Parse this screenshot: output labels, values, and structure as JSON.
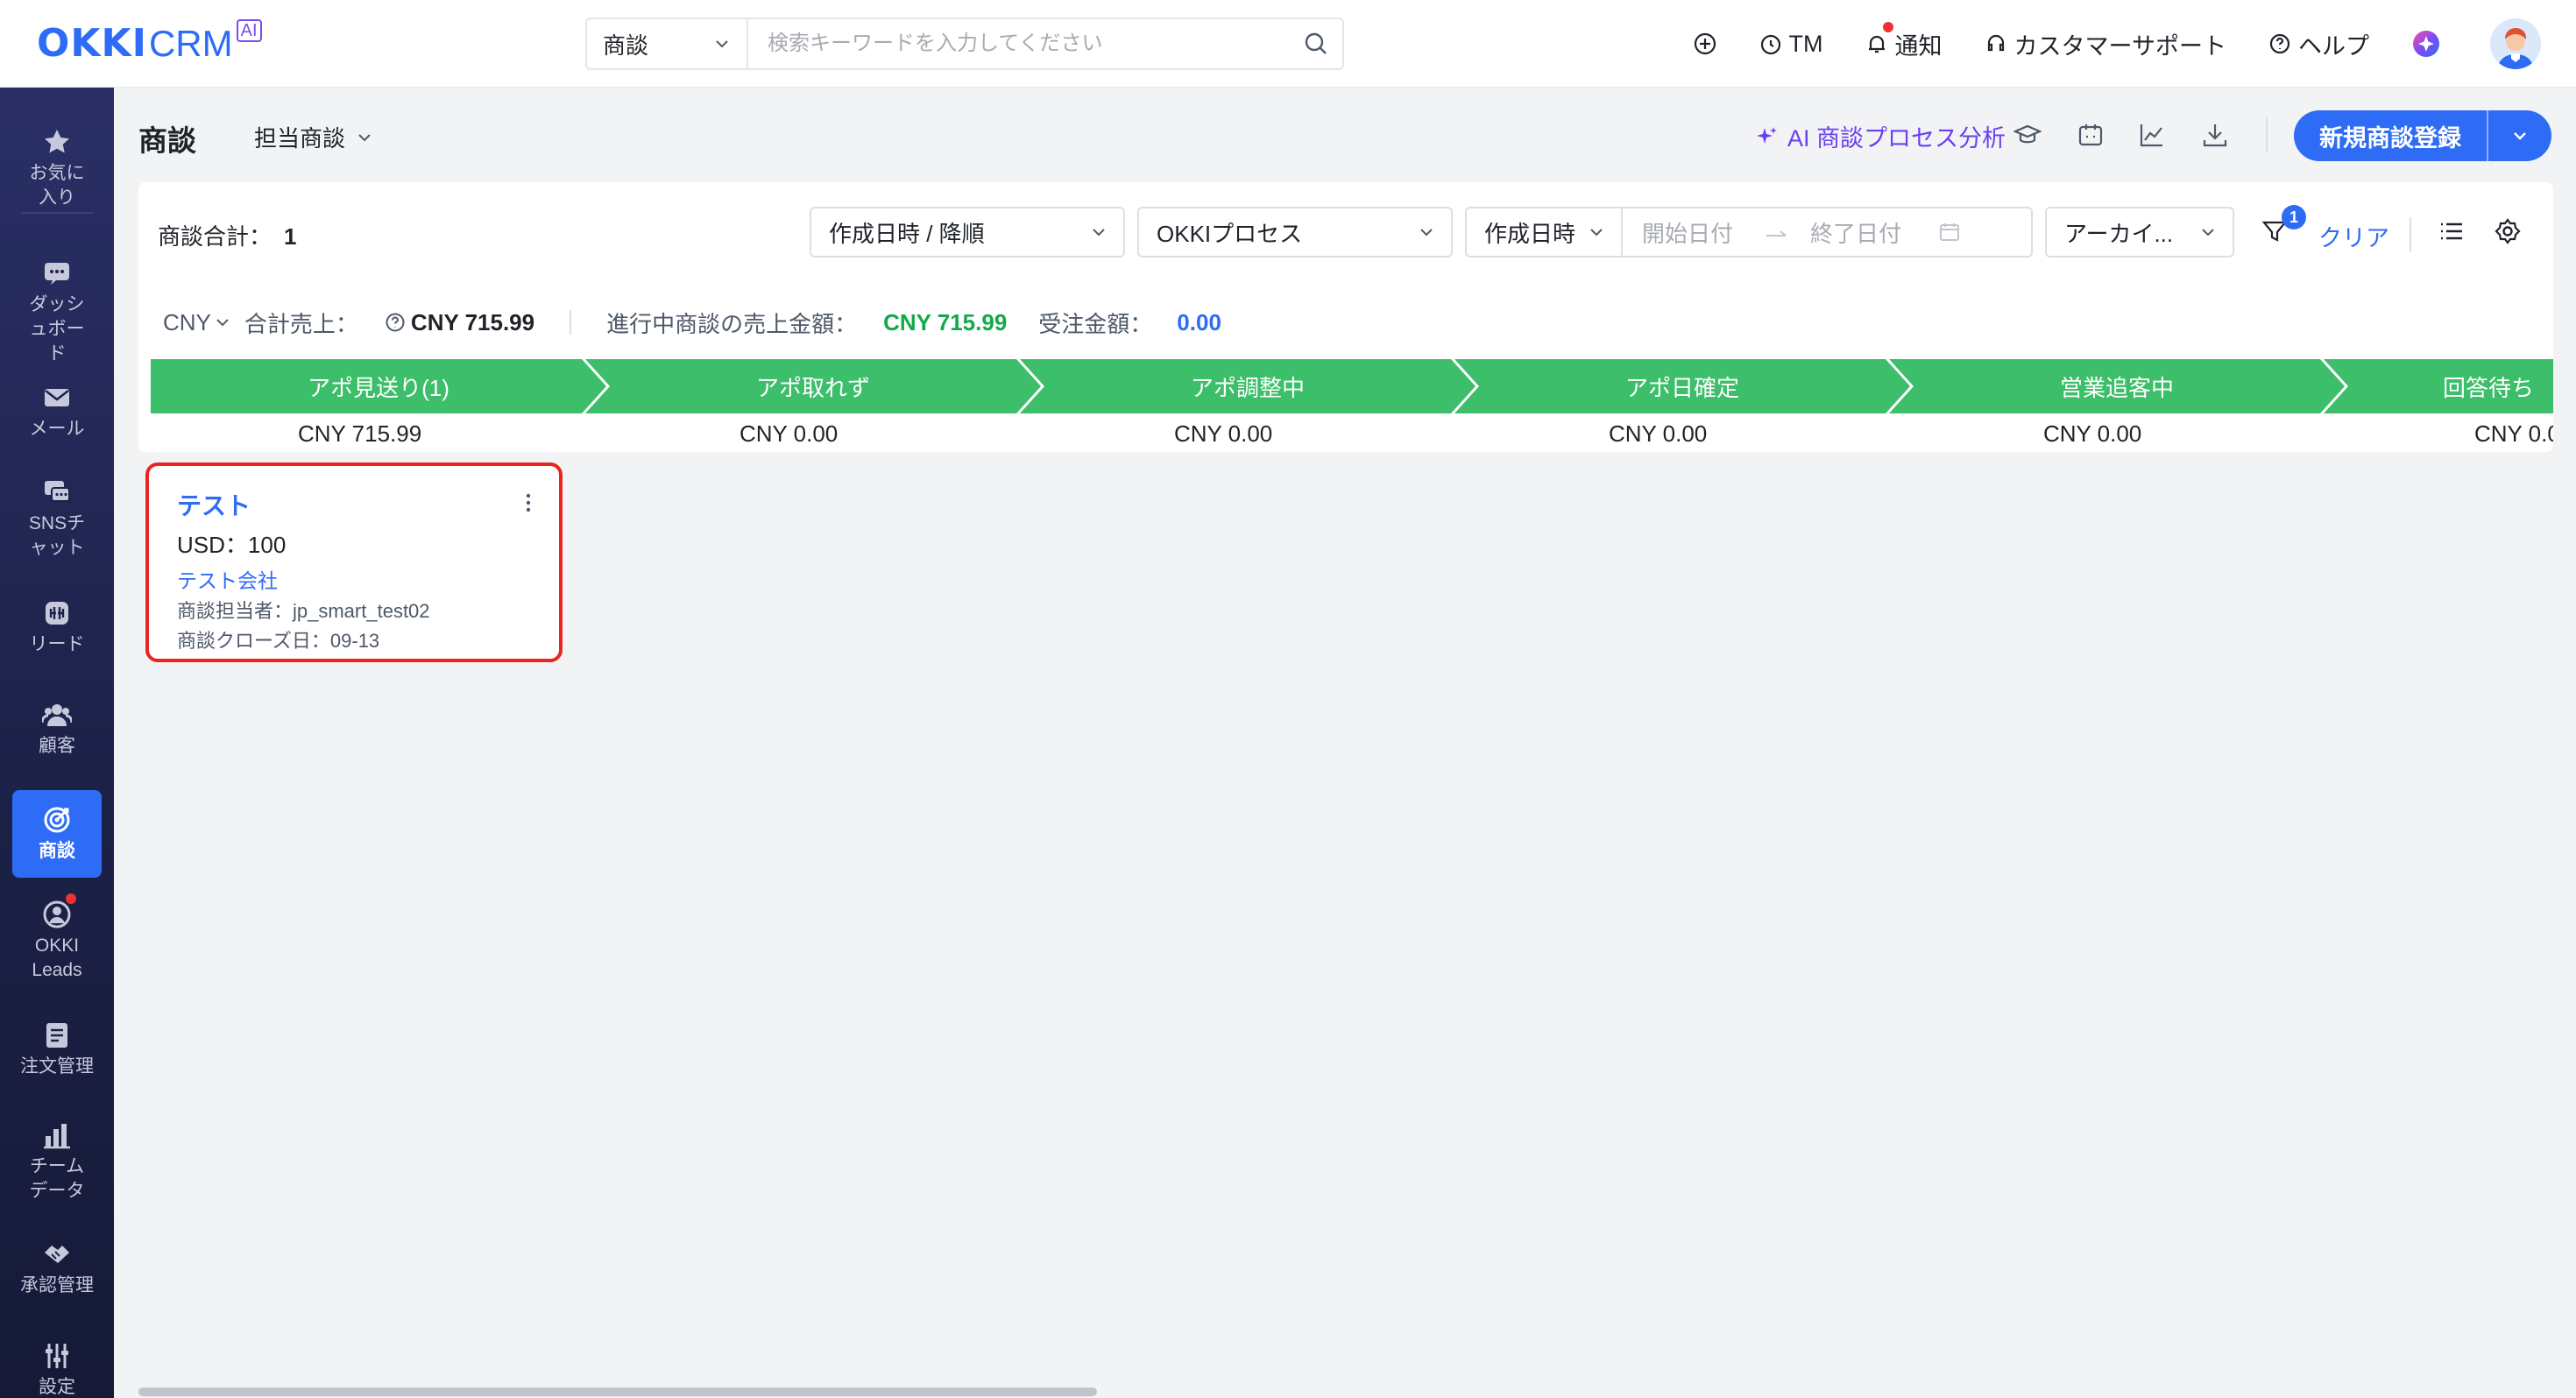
{
  "header": {
    "logo_text": "OKKI",
    "logo_crm": "CRM",
    "logo_ai": "AI",
    "search_scope": "商談",
    "search_placeholder": "検索キーワードを入力してください",
    "actions": {
      "tm": "TM",
      "notify": "通知",
      "support": "カスタマーサポート",
      "help": "ヘルプ"
    }
  },
  "sidebar": {
    "items": [
      {
        "label": "お気に入り",
        "icon": "star-icon"
      },
      {
        "label": "ダッシュボード",
        "icon": "dashboard-icon"
      },
      {
        "label": "メール",
        "icon": "mail-icon"
      },
      {
        "label": "SNSチャット",
        "icon": "chat-icon"
      },
      {
        "label": "リード",
        "icon": "lead-icon"
      },
      {
        "label": "顧客",
        "icon": "customers-icon"
      },
      {
        "label": "商談",
        "icon": "target-icon",
        "active": true
      },
      {
        "label": "OKKI Leads",
        "icon": "okki-leads-icon"
      },
      {
        "label": "注文管理",
        "icon": "order-icon"
      },
      {
        "label": "チームデータ",
        "icon": "team-data-icon"
      },
      {
        "label": "承認管理",
        "icon": "approval-icon"
      },
      {
        "label": "設定",
        "icon": "settings-icon"
      }
    ]
  },
  "page": {
    "title": "商談",
    "view_select": "担当商談",
    "ai_link": "AI 商談プロセス分析",
    "new_button": "新規商談登録"
  },
  "toolbar": {
    "total_label": "商談合計：",
    "total_value": "1",
    "sort": "作成日時 / 降順",
    "process": "OKKIプロセス",
    "date_type": "作成日時",
    "start_placeholder": "開始日付",
    "end_placeholder": "終了日付",
    "archive": "アーカイ...",
    "filter_count": "1",
    "clear": "クリア"
  },
  "summary": {
    "currency": "CNY",
    "total_sales_label": "合計売上：",
    "total_sales_value": "CNY 715.99",
    "in_progress_label": "進行中商談の売上金額：",
    "in_progress_value": "CNY 715.99",
    "won_label": "受注金額：",
    "won_value": "0.00"
  },
  "stages": [
    {
      "label": "アポ見送り(1)",
      "amount": "CNY 715.99"
    },
    {
      "label": "アポ取れず",
      "amount": "CNY 0.00"
    },
    {
      "label": "アポ調整中",
      "amount": "CNY 0.00"
    },
    {
      "label": "アポ日確定",
      "amount": "CNY 0.00"
    },
    {
      "label": "営業追客中",
      "amount": "CNY 0.00"
    },
    {
      "label": "回答待ち",
      "amount": "CNY 0.0"
    }
  ],
  "colors": {
    "accent": "#2e6cf6",
    "stage_green": "#3dbe6a",
    "highlight_red": "#e8251f",
    "ai_purple": "#6b3ff2"
  },
  "card": {
    "title": "テスト",
    "value": "USD：100",
    "company": "テスト会社",
    "owner": "商談担当者：jp_smart_test02",
    "close_date": "商談クローズ日：09-13"
  }
}
